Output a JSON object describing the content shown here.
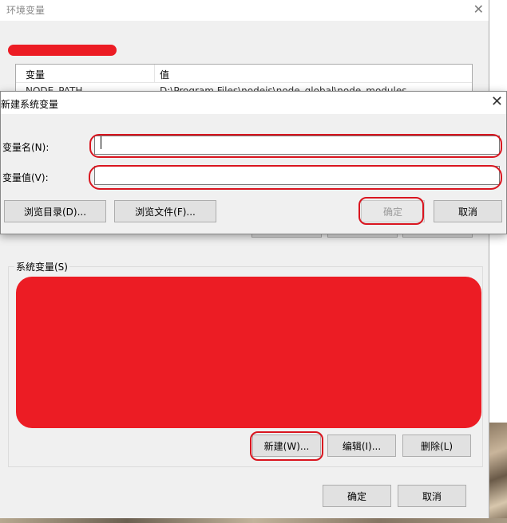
{
  "env_window": {
    "title": "环境变量",
    "close_glyph": "✕",
    "user_table": {
      "columns": [
        "变量",
        "值"
      ],
      "first_row": {
        "name": "NODE_PATH",
        "value": "D:\\Program Files\\nodejs\\node_global\\node_modules"
      }
    },
    "system_vars_label": "系统变量(S)",
    "buttons": {
      "new": "新建(W)...",
      "edit": "编辑(I)...",
      "delete": "删除(L)"
    },
    "footer": {
      "ok": "确定",
      "cancel": "取消"
    }
  },
  "new_dialog": {
    "title": "新建系统变量",
    "close_glyph": "✕",
    "name_label": "变量名(N):",
    "value_label": "变量值(V):",
    "name_value": "",
    "value_value": "",
    "browse_dir": "浏览目录(D)...",
    "browse_file": "浏览文件(F)...",
    "ok": "确定",
    "cancel": "取消"
  },
  "colors": {
    "annotation_red": "#d9151f",
    "redaction_red": "#ec1c24"
  }
}
